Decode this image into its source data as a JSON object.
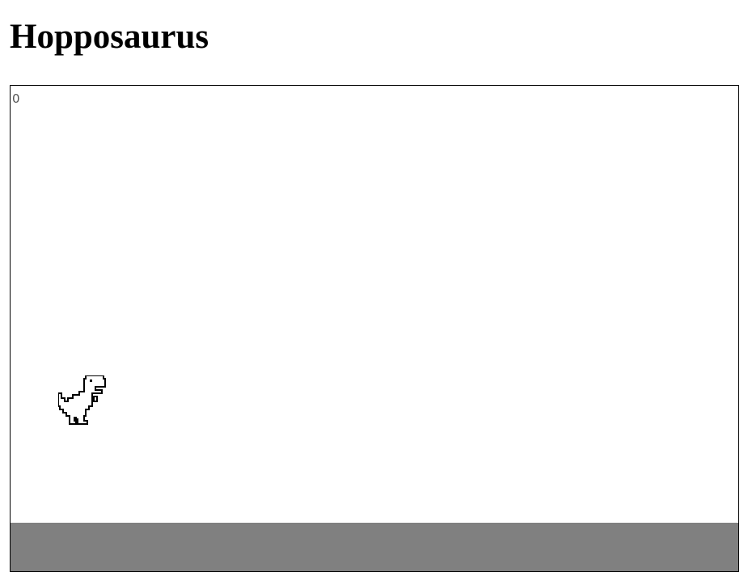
{
  "header": {
    "title": "Hopposaurus"
  },
  "game": {
    "score": "0",
    "player_icon": "dinosaur-icon",
    "colors": {
      "background": "#ffffff",
      "ground": "#808080",
      "border": "#000000",
      "score_text": "#535353",
      "dino_outline": "#000000"
    }
  }
}
